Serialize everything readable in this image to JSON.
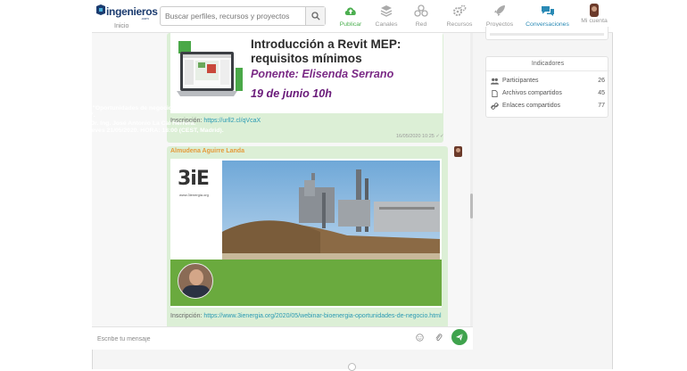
{
  "header": {
    "logo_text": "ingenieros",
    "logo_sub": ".com",
    "home_label": "Inicio",
    "search_placeholder": "Buscar perfiles, recursos y proyectos",
    "nav": [
      {
        "label": "Publicar",
        "icon": "cloud-upload-icon"
      },
      {
        "label": "Canales",
        "icon": "layers-icon"
      },
      {
        "label": "Red",
        "icon": "network-icon"
      },
      {
        "label": "Recursos",
        "icon": "gears-icon"
      },
      {
        "label": "Proyectos",
        "icon": "rocket-icon"
      },
      {
        "label": "Conversaciones",
        "icon": "chat-bubbles-icon"
      },
      {
        "label": "Mi cuenta",
        "icon": "user-avatar"
      }
    ]
  },
  "messages": [
    {
      "poster": {
        "title": "Introducción a Revit MEP: requisitos mínimos",
        "speaker": "Ponente: Elisenda Serrano",
        "date": "19 de junio  10h"
      },
      "caption_prefix": "Inscripción: ",
      "caption_link": "https://urll2.cl/qVcaX",
      "time": "16/05/2020 10:25 ✓✓"
    },
    {
      "sender": "Almudena Aguirre Landa",
      "poster": {
        "logo": "3iE",
        "logo_url": "www.3ienergia.org",
        "banner_lines": [
          "WEBINAR: \"Oportunidades de negocio en el ámbito de la",
          "bioenergía\".",
          "IMPARTE: Dr. Ing. José Antonio La Cal Herrera.",
          "FECHA: Jueves 21/05/2020. HORA: 18:00 (CEST, Madrid)."
        ]
      },
      "caption_prefix": "Inscripción: ",
      "caption_link": "https://www.3ienergia.org/2020/05/webinar-bioenergia-oportunidades-de-negocio.html"
    }
  ],
  "composer": {
    "placeholder": "Escribe tu mensaje"
  },
  "indicators": {
    "title": "Indicadores",
    "rows": [
      {
        "label": "Participantes",
        "value": "26",
        "icon": "users-icon"
      },
      {
        "label": "Archivos compartidos",
        "value": "45",
        "icon": "file-icon"
      },
      {
        "label": "Enlaces compartidos",
        "value": "77",
        "icon": "link-icon"
      }
    ]
  },
  "colors": {
    "accent": "#2a8ab5",
    "bubble": "#dcefd6",
    "send": "#3fa34d",
    "speaker_purple": "#7b2a86",
    "sender_orange": "#e59a3a",
    "banner_green": "#6aaa3e"
  }
}
